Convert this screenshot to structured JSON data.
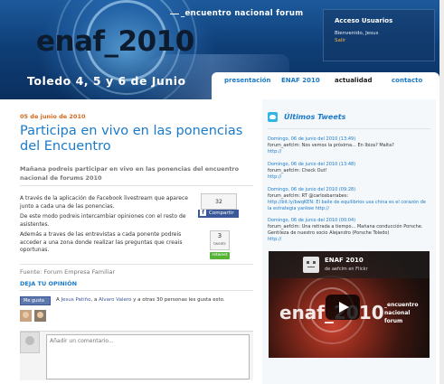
{
  "header": {
    "logo": "enaf_2010",
    "subtitle": "_encuentro nacional forum",
    "dates": "Toledo 4, 5 y 6 de Junio",
    "user_box": {
      "title": "Acceso Usuarios",
      "welcome": "Bienvenido, Jesus",
      "exit": "Salir"
    },
    "nav": [
      {
        "label": "presentación",
        "active": false
      },
      {
        "label": "ENAF 2010",
        "active": false
      },
      {
        "label": "actualidad",
        "active": true
      },
      {
        "label": "contacto",
        "active": false
      }
    ]
  },
  "article": {
    "date": "05 de junio de 2010",
    "title": "Participa en vivo en las ponencias del Encuentro",
    "lead": "Mañana podreis participar en vivo en las ponencias del encuentro nacional de forums 2010",
    "paragraphs": [
      "A través de la aplicación de Facebook livestream que aparece junto a cada una de las ponencias.",
      "De este modo podreis intercambiar opiniones con el resto de asistentes.",
      "Además a traves de las entrevistas a cada ponente podreis acceder a una zona donde realizar las preguntas que creais oportunas."
    ],
    "share": {
      "count": "32",
      "label": "Compartir"
    },
    "tweet": {
      "count": "3",
      "unit": "tweets",
      "label": "retweet"
    },
    "source": "Fuente: Forum Empresa Familiar",
    "opinion_heading": "DEJA TU OPINIÓN",
    "like": {
      "button": "Me gusta",
      "prefix": "A",
      "name1": "Jesus Patiño",
      "middle": ", a",
      "name2": "Alvaro Valero",
      "suffix": "y a otras 30 personas les gusta esto."
    },
    "comment_placeholder": "Añadir un comentario..."
  },
  "sidebar": {
    "twitter_title": "Últimos Tweets",
    "tweets": [
      {
        "date": "Domingo, 06 de junio del 2010 (13:49)",
        "text": "forum_aefclm: Nos vemos la próxima... En Ibiza? Malta?",
        "link": "http://"
      },
      {
        "date": "Domingo, 06 de junio del 2010 (13:48)",
        "text": "forum_aefclm: Check Out!",
        "link": "http://"
      },
      {
        "date": "Domingo, 06 de junio del 2010 (09:28)",
        "text": "forum_aefclm: RT @carlosbarrabes:",
        "text2": "http://bit.ly/bwqKEN: El baile de equilibrios usa china es el corazón de la estrategia yankee",
        "link": "http://"
      },
      {
        "date": "Domingo, 06 de junio del 2010 (00:04)",
        "text": "forum_aefclm: Una retirada a tiempo... Mañana conducción Porsche. Gentileza de nuestro socio Alejandro (Porsche Toledo)",
        "link": "http://"
      }
    ],
    "video": {
      "title": "ENAF 2010",
      "byline": "de aefclm en Flickr",
      "logo": "enaf_2010",
      "side_text": "_encuentro nacional forum"
    }
  },
  "colors": {
    "accent": "#1a7ac9",
    "date": "#d2691e",
    "header_bg": "#0f3f78",
    "facebook": "#3b5998",
    "retweet": "#55b335"
  }
}
